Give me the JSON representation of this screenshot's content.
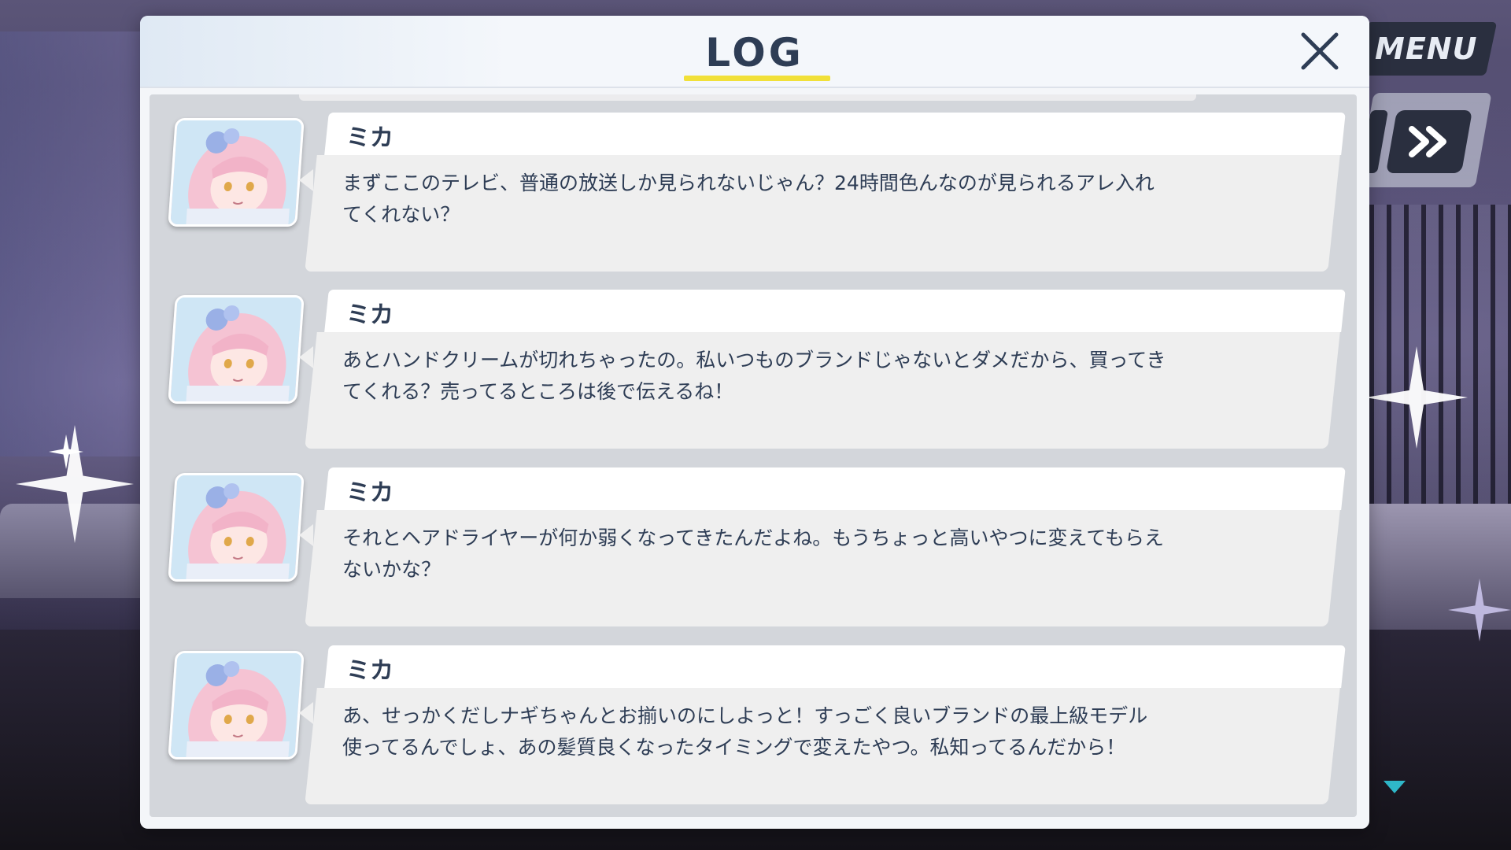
{
  "modal": {
    "title": "LOG",
    "close_icon": "close-icon",
    "accent_color": "#f1e039"
  },
  "right_ui": {
    "menu_label": "MENU",
    "fast_forward_icon": "fast-forward-icon"
  },
  "log": {
    "entries": [
      {
        "speaker": "ミカ",
        "avatar_icon": "mika-avatar-icon",
        "text": "まずここのテレビ、普通の放送しか見られないじゃん？24時間色んなのが見られるアレ入れ\nてくれない？"
      },
      {
        "speaker": "ミカ",
        "avatar_icon": "mika-avatar-icon",
        "text": "あとハンドクリームが切れちゃったの。私いつものブランドじゃないとダメだから、買ってき\nてくれる？売ってるところは後で伝えるね！"
      },
      {
        "speaker": "ミカ",
        "avatar_icon": "mika-avatar-icon",
        "text": "それとヘアドライヤーが何か弱くなってきたんだよね。もうちょっと高いやつに変えてもらえ\nないかな？"
      },
      {
        "speaker": "ミカ",
        "avatar_icon": "mika-avatar-icon",
        "text": "あ、せっかくだしナギちゃんとお揃いのにしよっと！すっごく良いブランドの最上級モデル\n使ってるんでしょ、あの髪質良くなったタイミングで変えたやつ。私知ってるんだから！"
      }
    ]
  },
  "colors": {
    "text_dark": "#2e3d55",
    "button_dark": "#2a2f3f",
    "scroll_indicator": "#2fb7c8"
  }
}
